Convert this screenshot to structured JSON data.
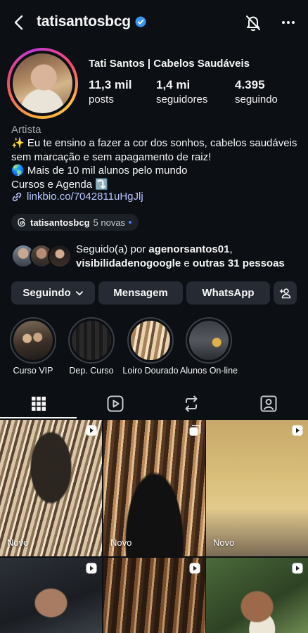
{
  "header": {
    "username": "tatisantosbcg",
    "icons": [
      "back-icon",
      "verified-icon",
      "notifications-off-icon",
      "more-icon"
    ]
  },
  "profile": {
    "display_name": "Tati Santos | Cabelos Saudáveis",
    "stats": [
      {
        "value": "11,3 mil",
        "label": "posts"
      },
      {
        "value": "1,4 mi",
        "label": "seguidores"
      },
      {
        "value": "4.395",
        "label": "seguindo"
      }
    ],
    "category": "Artista",
    "bio_lines": [
      "✨ Eu te ensino a fazer a cor dos sonhos, cabelos saudáveis sem marcação e sem apagamento de raiz!",
      "🌎 Mais de 10 mil alunos pelo mundo",
      "Cursos e Agenda ⤵️"
    ],
    "link": "linkbio.co/7042811uHgJlj",
    "threads": {
      "username": "tatisantosbcg",
      "new_label": "5 novas"
    }
  },
  "followed_by": {
    "prefix": "Seguido(a) por ",
    "user1": "agenorsantos01",
    "sep": ",",
    "user2": "visibilidadenogoogle",
    "mid": " e ",
    "others": "outras 31 pessoas"
  },
  "actions": {
    "following": "Seguindo",
    "message": "Mensagem",
    "whatsapp": "WhatsApp"
  },
  "highlights": [
    {
      "label": "Curso VIP"
    },
    {
      "label": "Dep. Curso"
    },
    {
      "label": "Loiro Dourado"
    },
    {
      "label": "Alunos On-line"
    }
  ],
  "tabs": [
    "grid-icon",
    "reels-icon",
    "reposts-icon",
    "tagged-icon"
  ],
  "grid": [
    {
      "label": "Novo",
      "badge": "reel-icon"
    },
    {
      "label": "Novo",
      "badge": "carousel-icon"
    },
    {
      "label": "Novo",
      "badge": "reel-icon"
    },
    {
      "label": "",
      "badge": "reel-icon"
    },
    {
      "label": "",
      "badge": "reel-icon"
    },
    {
      "label": "",
      "badge": "reel-icon"
    }
  ],
  "colors": {
    "background": "#0c0f14",
    "button": "#252a33",
    "link": "#b7c6ff",
    "verified": "#3797f0"
  }
}
